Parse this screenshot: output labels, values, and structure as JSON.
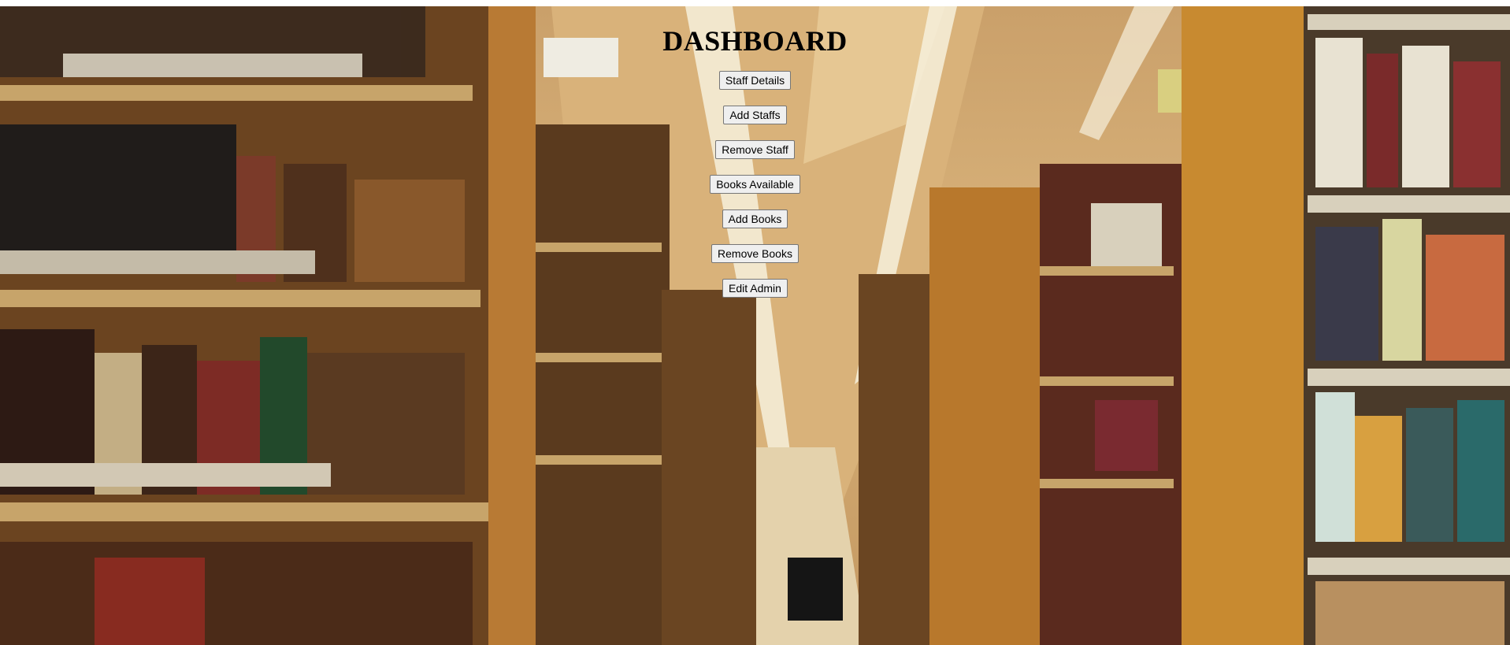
{
  "page": {
    "title": "DASHBOARD"
  },
  "menu": {
    "items": [
      {
        "id": "staff-details",
        "label": "Staff Details"
      },
      {
        "id": "add-staffs",
        "label": "Add Staffs"
      },
      {
        "id": "remove-staff",
        "label": "Remove Staff"
      },
      {
        "id": "books-available",
        "label": "Books Available"
      },
      {
        "id": "add-books",
        "label": "Add Books"
      },
      {
        "id": "remove-books",
        "label": "Remove Books"
      },
      {
        "id": "edit-admin",
        "label": "Edit Admin"
      }
    ]
  },
  "background": {
    "subject": "library bookshelves aisle",
    "colors": {
      "wood": "#b8782c",
      "wood_dark": "#7a4a18",
      "ceiling": "#d9b27a",
      "light": "#f6f0dc"
    }
  }
}
